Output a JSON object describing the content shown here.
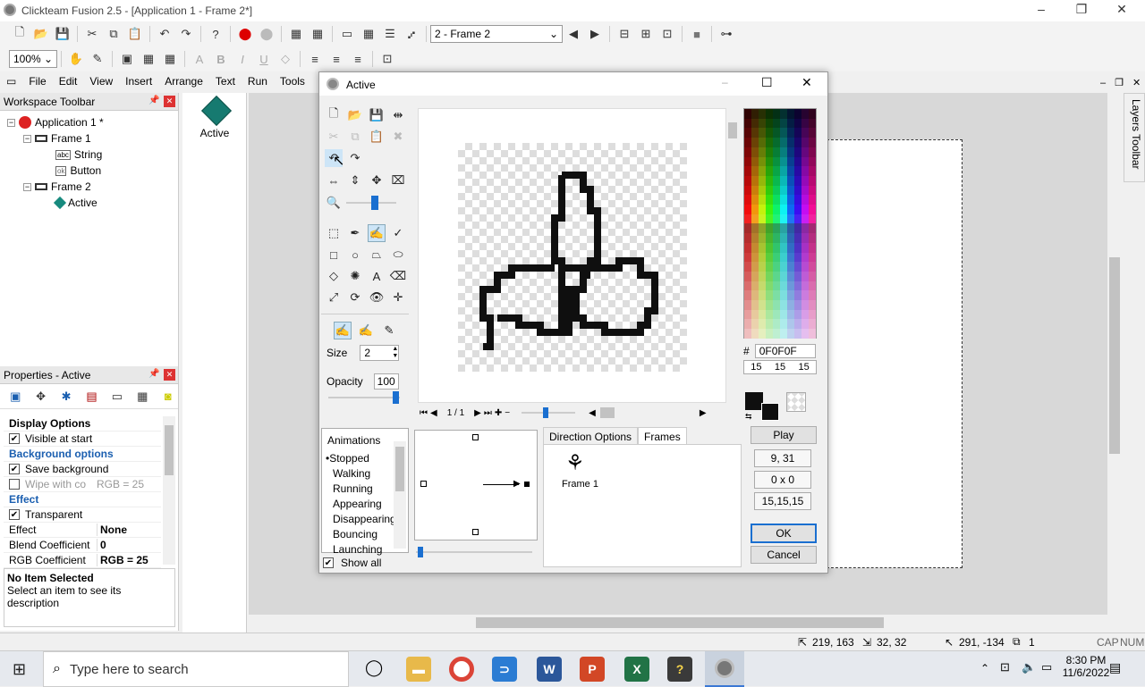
{
  "window": {
    "title": "Clickteam Fusion 2.5 - [Application 1 - Frame 2*]"
  },
  "toolbar1": {
    "frame_combo": "2 - Frame 2"
  },
  "toolbar2": {
    "zoom": "100%"
  },
  "menu": [
    "File",
    "Edit",
    "View",
    "Insert",
    "Arrange",
    "Text",
    "Run",
    "Tools"
  ],
  "workspace": {
    "title": "Workspace Toolbar",
    "tree": [
      {
        "label": "Application 1 *",
        "level": 0
      },
      {
        "label": "Frame 1",
        "level": 1
      },
      {
        "label": "String",
        "level": 2
      },
      {
        "label": "Button",
        "level": 2
      },
      {
        "label": "Frame 2",
        "level": 1
      },
      {
        "label": "Active",
        "level": 2
      }
    ]
  },
  "object_shelf": {
    "label": "Active"
  },
  "properties": {
    "title": "Properties - Active",
    "rows": [
      {
        "kind": "cat",
        "label": "Display Options"
      },
      {
        "kind": "check",
        "label": "Visible at start",
        "checked": "✔"
      },
      {
        "kind": "cat",
        "label": "Background options"
      },
      {
        "kind": "check",
        "label": "Save background",
        "checked": "✔"
      },
      {
        "kind": "check",
        "label": "Wipe with co",
        "checked": "",
        "value": "RGB = 25"
      },
      {
        "kind": "cat",
        "label": "Effect"
      },
      {
        "kind": "check",
        "label": "Transparent",
        "checked": "✔"
      },
      {
        "kind": "val",
        "label": "Effect",
        "value": "None"
      },
      {
        "kind": "val",
        "label": "Blend Coefficient",
        "value": "0"
      },
      {
        "kind": "val",
        "label": "RGB Coefficient",
        "value": "RGB = 25"
      }
    ],
    "desc_title": "No Item Selected",
    "desc_text": "Select an item to see its description"
  },
  "layers_toolbar": "Layers Toolbar",
  "dialog": {
    "title": "Active",
    "size_label": "Size",
    "size_value": "2",
    "opacity_label": "Opacity",
    "opacity_value": "100",
    "frame_counter": "1 / 1",
    "hex_prefix": "#",
    "hex_value": "0F0F0F",
    "rgb": [
      "15",
      "15",
      "15"
    ],
    "play_label": "Play",
    "coords": "9, 31",
    "selection": "0 x 0",
    "color_readout": "15,15,15",
    "ok_label": "OK",
    "cancel_label": "Cancel",
    "animations_header": "Animations",
    "animations": [
      "Stopped",
      "Walking",
      "Running",
      "Appearing",
      "Disappearing",
      "Bouncing",
      "Launching"
    ],
    "show_all": "Show all",
    "tabs": [
      "Direction Options",
      "Frames"
    ],
    "frame_label": "Frame 1"
  },
  "status": {
    "pos": "219, 163",
    "size": "32, 32",
    "mouse": "291, -134",
    "layer": "1",
    "caps": "CAP",
    "num": "NUM"
  },
  "taskbar": {
    "search": "Type here to search",
    "time": "8:30 PM",
    "date": "11/6/2022"
  }
}
